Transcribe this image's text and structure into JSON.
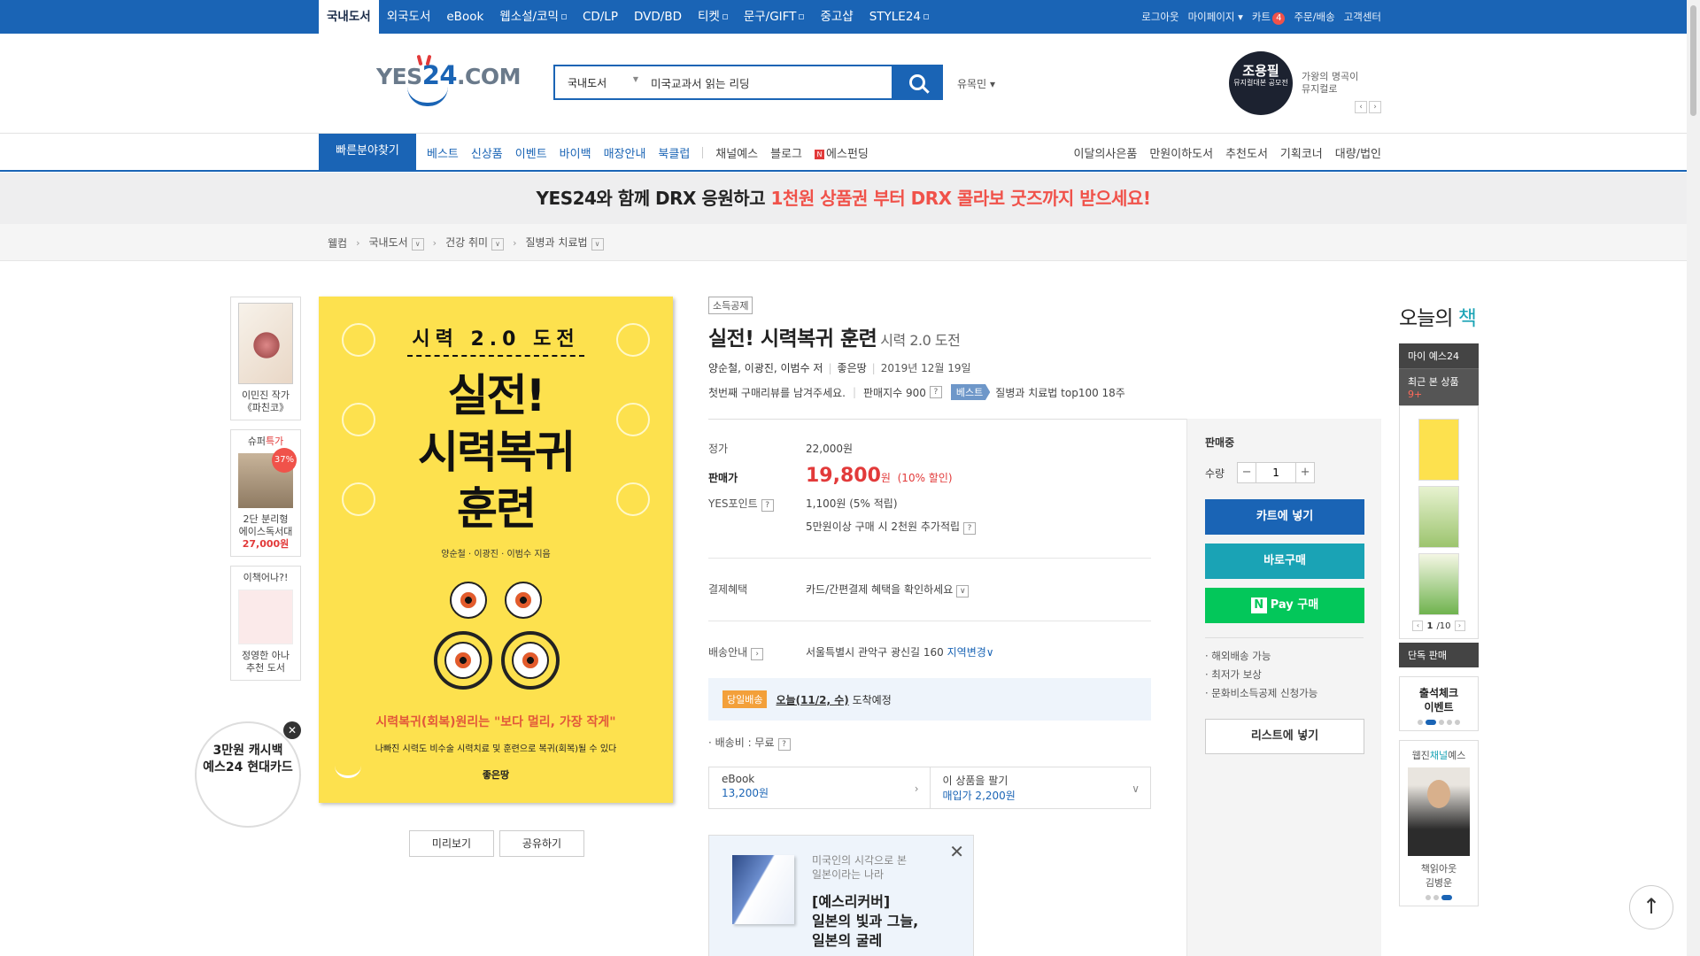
{
  "topnav": {
    "items": [
      "국내도서",
      "외국도서",
      "eBook",
      "웹소설/코믹",
      "CD/LP",
      "DVD/BD",
      "티켓",
      "문구/GIFT",
      "중고샵",
      "STYLE24"
    ],
    "right": {
      "logout": "로그아웃",
      "mypage": "마이페이지",
      "cart": "카트",
      "cart_count": "4",
      "order": "주문/배송",
      "cs": "고객센터"
    }
  },
  "header": {
    "logo_a": "YES",
    "logo_b": "24",
    "logo_c": ".COM",
    "search_category": "국내도서",
    "search_value": "미국교과서 읽는 리딩",
    "user": "유목민",
    "promo_name": "조용필",
    "promo_sub": "뮤지컬대본 공모전",
    "promo_text1": "가왕의 명곡이",
    "promo_text2": "뮤지컬로"
  },
  "gnb": {
    "quick": "빠른분야찾기",
    "links_blue": [
      "베스트",
      "신상품",
      "이벤트",
      "바이백",
      "매장안내",
      "북클럽"
    ],
    "links_gray": [
      "채널예스",
      "블로그",
      "에스펀딩"
    ],
    "right": [
      "이달의사은품",
      "만원이하도서",
      "추천도서",
      "기획코너",
      "대량/법인"
    ]
  },
  "banner": {
    "part1": "YES24와 함께 DRX 응원하고 ",
    "part2": "1천원 상품권 부터 DRX 콜라보 굿즈까지 받으세요!"
  },
  "breadcrumb": [
    "웰컴",
    "국내도서",
    "건강 취미",
    "질병과 치료법"
  ],
  "leftside": {
    "card1": [
      "이민진 작가",
      "《파친코》"
    ],
    "card2": {
      "head_a": "슈퍼",
      "head_b": "특가",
      "pct": "37%",
      "name1": "2단 분리형",
      "name2": "에이스독서대",
      "price": "27,000원"
    },
    "card3": {
      "head": "이책어나?!",
      "name1": "정영한 아나",
      "name2": "추천 도서"
    },
    "card_ad": [
      "3만원 캐시백",
      "예스24 현대카드"
    ]
  },
  "cover": {
    "top": "시력 2.0 도전",
    "title1": "실전!",
    "title2": "시력복귀",
    "title3": "훈련",
    "authors": "양순철 · 이광진 · 이범수 지음",
    "sub": "시력복귀(회복)원리는 \"보다 멀리, 가장 작게\"",
    "sub2": "나빠진 시력도 비수술 시력치료 및 훈련으로 복귀(회복)될 수 있다",
    "publisher": "좋은땅"
  },
  "cover_buttons": [
    "미리보기",
    "공유하기"
  ],
  "product": {
    "tag": "소득공제",
    "title": "실전! 시력복귀 훈련",
    "subtitle": "시력 2.0 도전",
    "authors": "양순철, 이광진, 이범수 저",
    "publisher": "좋은땅",
    "date": "2019년 12월 19일",
    "review": "첫번째 구매리뷰를 남겨주세요.",
    "sales_index": "판매지수 900",
    "best_label": "베스트",
    "best_text": "질병과 치료법 top100 18주",
    "price_label": "정가",
    "price": "22,000원",
    "sale_label": "판매가",
    "sale_price": "19,800",
    "sale_unit": "원",
    "discount": "(10% 할인)",
    "point_label": "YES포인트",
    "point": "1,100원 (5% 적립)",
    "point_extra": "5만원이상 구매 시 2천원 추가적립",
    "benefit_label": "결제혜택",
    "benefit": "카드/간편결제 혜택을 확인하세요",
    "delivery_label": "배송안내",
    "delivery": "서울특별시 관악구 광신길 160",
    "region_change": "지역변경",
    "sameday": "당일배송",
    "arrival_date": "오늘(11/2, 수)",
    "arrival_text": "도착예정",
    "ship_fee": "· 배송비 : 무료",
    "ebook_label": "eBook",
    "ebook_price": "13,200원",
    "sell_label": "이 상품을 팔기",
    "sell_price": "매입가 2,200원"
  },
  "ad": {
    "t1a": "미국인의 시각으로 본",
    "t1b": "일본이라는 나라",
    "t2a": "[예스리커버]",
    "t2b": "일본의 빛과 그늘,",
    "t2c": "일본의 굴레"
  },
  "buy": {
    "status": "판매중",
    "qty_label": "수량",
    "qty": "1",
    "cart": "카트에 넣기",
    "buynow": "바로구매",
    "npay": "Pay 구매",
    "list": [
      "· 해외배송 가능",
      "· 최저가 보상",
      "· 문화비소득공제 신청가능"
    ],
    "wishlist": "리스트에 넣기"
  },
  "rightside": {
    "title_a": "오늘의 ",
    "title_b": "책",
    "my": "마이 예스24",
    "recent": "최근 본 상품",
    "recent_count": "9+",
    "page": "1",
    "page_total": "/10",
    "solo": "단독 판매",
    "event1": "출석체크",
    "event2": "이벤트",
    "ch_a": "웹진",
    "ch_b": "채널",
    "ch_c": "예스",
    "person1": "책읽아웃",
    "person2": "김병운"
  },
  "colors": {
    "brand": "#1a64b5",
    "accent_red": "#e23a3a",
    "npay": "#03c75a",
    "teal": "#1aa3b5"
  }
}
